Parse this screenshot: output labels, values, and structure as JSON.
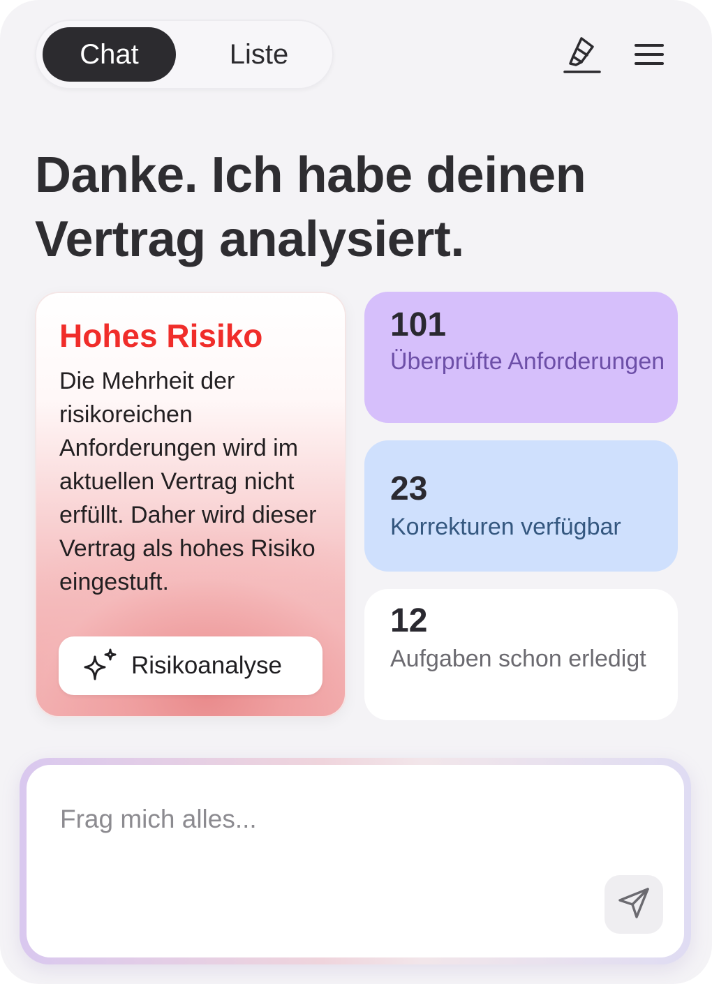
{
  "header": {
    "tabs": [
      {
        "label": "Chat",
        "active": true
      },
      {
        "label": "Liste",
        "active": false
      }
    ],
    "icons": [
      "highlighter-icon",
      "menu-icon"
    ]
  },
  "headline": "Danke. Ich habe deinen Vertrag analysiert.",
  "risk_card": {
    "title": "Hohes Risiko",
    "body": "Die Mehrheit der risikoreichen Anforderungen wird im aktuellen Vertrag nicht erfüllt. Daher wird dieser Vertrag als hohes Risiko eingestuft.",
    "button_label": "Risikoanalyse",
    "button_icon": "sparkle-icon",
    "title_color": "#f02d2a"
  },
  "stats": [
    {
      "value": "101",
      "label": "Überprüfte Anforderungen",
      "color": "#d6bffb"
    },
    {
      "value": "23",
      "label": "Korrekturen verfügbar",
      "color": "#cfe0fd"
    },
    {
      "value": "12",
      "label": "Aufgaben schon erledigt",
      "color": "#ffffff"
    }
  ],
  "chat_input": {
    "value": "",
    "placeholder": "Frag mich alles...",
    "send_icon": "send-icon"
  }
}
